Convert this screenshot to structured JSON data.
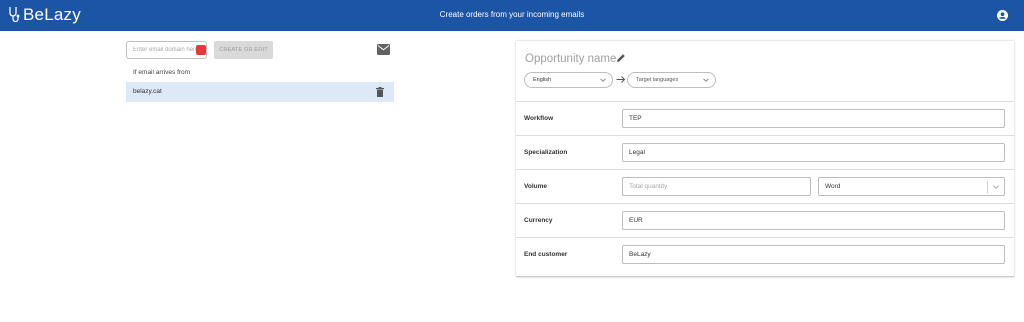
{
  "app": {
    "name": "BeLazy",
    "title": "Create orders from your incoming emails"
  },
  "left_panel": {
    "domain_input_placeholder": "Enter email domain here",
    "create_button_label": "CREATE OR EDIT",
    "section_label": "If email arrives from",
    "domains": [
      {
        "name": "belazy.cat"
      }
    ]
  },
  "right_panel": {
    "opportunity_name_placeholder": "Opportunity name",
    "source_language": "English",
    "target_languages_placeholder": "Target languages",
    "rows": {
      "workflow": {
        "label": "Workflow",
        "value": "TEP"
      },
      "specialization": {
        "label": "Specialization",
        "value": "Legal"
      },
      "volume": {
        "label": "Volume",
        "quantity_placeholder": "Total quantity",
        "unit": "Word"
      },
      "currency": {
        "label": "Currency",
        "value": "EUR"
      },
      "end_customer": {
        "label": "End customer",
        "value": "BeLazy"
      }
    }
  },
  "colors": {
    "topbar": "#1c54a6",
    "selected_row": "#dde9f7",
    "badge": "#e53935"
  },
  "icons": [
    "stethoscope-logo-icon",
    "user-circle-icon",
    "mail-icon",
    "trash-icon",
    "pencil-icon",
    "chevron-down-icon",
    "arrow-right-icon"
  ]
}
